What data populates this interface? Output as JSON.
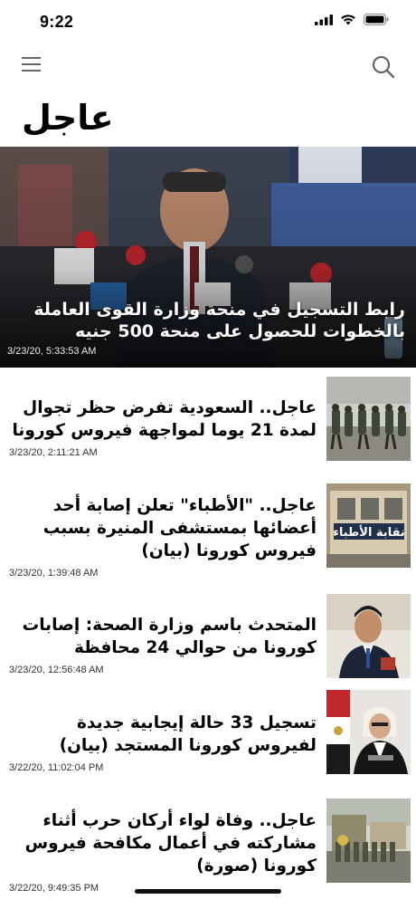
{
  "status": {
    "time": "9:22"
  },
  "header": {
    "title": "عاجل"
  },
  "hero": {
    "title": "رابط التسجيل في منحة وزارة القوى العاملة بالخطوات للحصول على منحة 500 جنيه",
    "date": "3/23/20, 5:33:53 AM"
  },
  "articles": [
    {
      "title": "عاجل.. السعودية تفرض حظر تجوال لمدة 21 يوما لمواجهة فيروس كورونا",
      "date": "3/23/20, 2:11:21 AM"
    },
    {
      "title": "عاجل.. \"الأطباء\" تعلن إصابة أحد أعضائها بمستشفى المنيرة بسبب فيروس كورونا (بيان)",
      "date": "3/23/20, 1:39:48 AM"
    },
    {
      "title": "المتحدث باسم وزارة الصحة: إصابات كورونا من حوالي 24 محافظة",
      "date": "3/23/20, 12:56:48 AM"
    },
    {
      "title": "تسجيل 33 حالة إيجابية جديدة لفيروس كورونا المستجد (بيان)",
      "date": "3/22/20, 11:02:04 PM"
    },
    {
      "title": "عاجل.. وفاة لواء أركان حرب أثناء مشاركته في أعمال مكافحة فيروس كورونا (صورة)",
      "date": "3/22/20, 9:49:35 PM"
    }
  ],
  "thumb_text": {
    "syndicate": "نقابة الأطباء"
  },
  "icons": [
    "menu-icon",
    "search-icon",
    "wifi-icon",
    "battery-icon",
    "signal-icon"
  ]
}
